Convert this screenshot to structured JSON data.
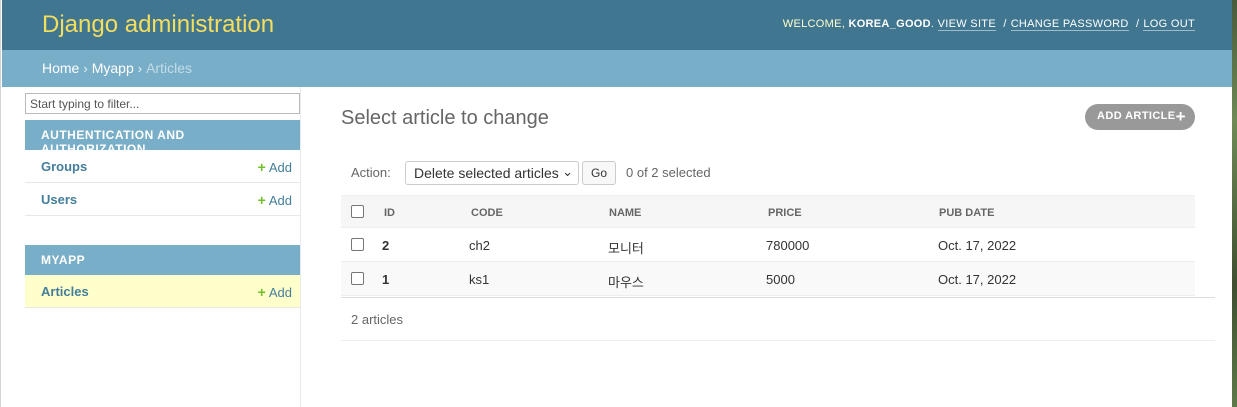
{
  "header": {
    "brand": "Django administration",
    "welcome": "WELCOME,",
    "username": "KOREA_GOOD",
    "view_site": "VIEW SITE",
    "change_password": "CHANGE PASSWORD",
    "log_out": "LOG OUT"
  },
  "breadcrumbs": {
    "home": "Home",
    "app": "Myapp",
    "current": "Articles"
  },
  "sidebar": {
    "filter_placeholder": "Start typing to filter...",
    "modules": [
      {
        "caption": "Authentication and Authorization",
        "rows": [
          {
            "name": "Groups",
            "add": "Add"
          },
          {
            "name": "Users",
            "add": "Add"
          }
        ]
      },
      {
        "caption": "Myapp",
        "rows": [
          {
            "name": "Articles",
            "add": "Add"
          }
        ]
      }
    ]
  },
  "content": {
    "title": "Select article to change",
    "add_button": "ADD ARTICLE"
  },
  "actions": {
    "label": "Action:",
    "selected_option": "Delete selected articles",
    "go": "Go",
    "selection_count": "0 of 2 selected"
  },
  "table": {
    "columns": [
      "ID",
      "CODE",
      "NAME",
      "PRICE",
      "PUB DATE"
    ],
    "rows": [
      {
        "id": "2",
        "code": "ch2",
        "name": "모니터",
        "price": "780000",
        "pub_date": "Oct. 17, 2022"
      },
      {
        "id": "1",
        "code": "ks1",
        "name": "마우스",
        "price": "5000",
        "pub_date": "Oct. 17, 2022"
      }
    ]
  },
  "paginator": {
    "text": "2 articles"
  },
  "colors": {
    "header_bg": "#417690",
    "brand": "#f5dd5d",
    "breadcrumb_bg": "#79aec8",
    "link": "#447e9b",
    "add_plus": "#70bf2b",
    "active_row": "#ffffcc"
  }
}
